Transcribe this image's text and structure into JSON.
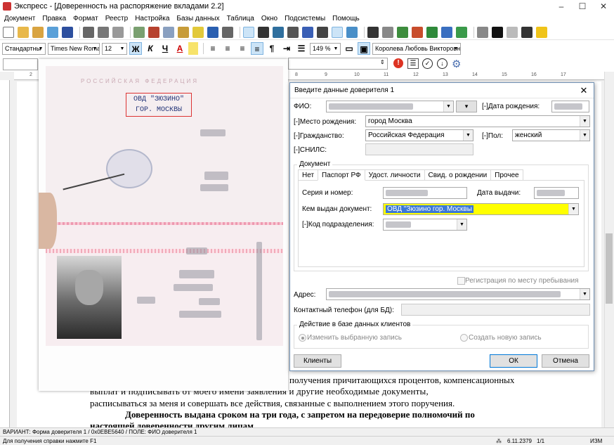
{
  "window": {
    "title": "Экспресс - [Доверенность на распоряжение вкладами 2.2]",
    "minimize": "–",
    "maximize": "☐",
    "close": "✕"
  },
  "menu": [
    "Документ",
    "Правка",
    "Формат",
    "Реестр",
    "Настройка",
    "Базы данных",
    "Таблица",
    "Окно",
    "Подсистемы",
    "Помощь"
  ],
  "format_toolbar": {
    "style": "Стандартны",
    "font": "Times New Roma",
    "size": "12",
    "bold": "Ж",
    "italic": "К",
    "underline": "Ч",
    "font_color": "A",
    "zoom": "149 %",
    "user": "Королева Любовь Викторовна"
  },
  "ruler_marks": [
    "2",
    "1",
    "1",
    "2",
    "3",
    "4",
    "5",
    "6",
    "7",
    "8",
    "9",
    "10",
    "11",
    "12",
    "13",
    "14",
    "15",
    "16",
    "17"
  ],
  "passport": {
    "header": "РОССИЙСКАЯ ФЕДЕРАЦИЯ",
    "issued_by_line1": "ОВД \"ЗЮЗИНО\"",
    "issued_by_line2": "ГОР. МОСКВЫ"
  },
  "dialog": {
    "title": "Введите данные доверителя 1",
    "close": "✕",
    "fio_label": "ФИО:",
    "birth_date_label": "[-]Дата рождения:",
    "birth_place_label": "[-]Место рождения:",
    "birth_place_value": "город Москва",
    "citizenship_label": "[-]Гражданство:",
    "citizenship_value": "Российская Федерация",
    "gender_label": "[-]Пол:",
    "gender_value": "женский",
    "snils_label": "[-]СНИЛС:",
    "document_group": "Документ",
    "tabs": [
      "Нет",
      "Паспорт РФ",
      "Удост. личности",
      "Свид. о рождении",
      "Прочее"
    ],
    "series_label": "Серия и номер:",
    "issue_date_label": "Дата выдачи:",
    "issued_by_label": "Кем выдан документ:",
    "issued_by_value": "ОВД \"Зюзино гор. Москвы",
    "division_code_label": "[-]Код подразделения:",
    "registration_label": "Регистрация по месту пребывания",
    "address_label": "Адрес:",
    "phone_label": "Контактный телефон (для БД):",
    "db_action_group": "Действие в базе данных клиентов",
    "radio_change": "Изменить выбранную запись",
    "radio_create": "Создать новую запись",
    "btn_clients": "Клиенты",
    "btn_ok": "ОК",
    "btn_cancel": "Отмена"
  },
  "document_text": {
    "line1": "получения причитающихся процентов, компенсационных",
    "line2": "выплат и подписывать от моего имени заявления и другие необходимые документы,",
    "line3": "расписываться за меня и совершать все действия, связанные с выполнением этого поручения.",
    "line4": "Доверенность выдана сроком на три года, с запретом на передоверие полномочий по",
    "line5": "настоящей доверенности другим лицам."
  },
  "status": {
    "line1": "ВАРИАНТ: Форма доверителя 1 / 0x0EBE5640  /  ПОЛЕ: ФИО доверителя 1",
    "help": "Для получения справки нажмите  F1",
    "version": "6.11.2379",
    "pages": "1/1",
    "mode": "ИЗМ"
  }
}
